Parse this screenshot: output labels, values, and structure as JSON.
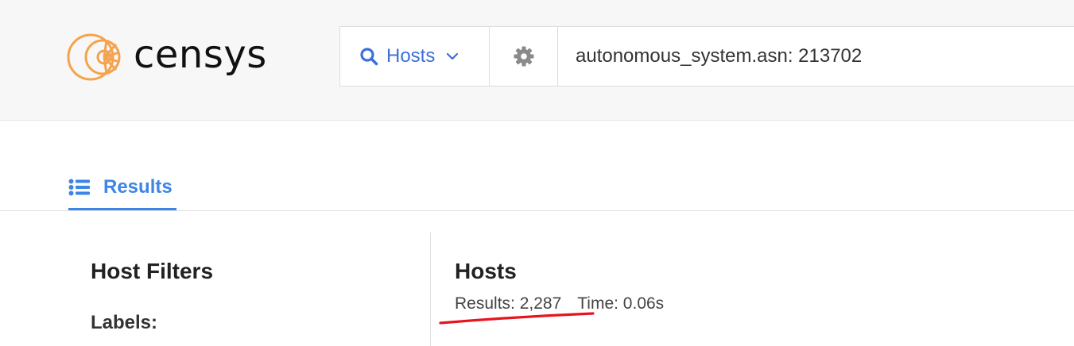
{
  "brand": {
    "name": "censys",
    "accent_color": "#f5a34d"
  },
  "search": {
    "type_label": "Hosts",
    "type_icon": "search-icon",
    "query": "autonomous_system.asn: 213702",
    "link_color": "#3d6fd9"
  },
  "tabs": [
    {
      "label": "Results",
      "icon": "list-icon",
      "active": true
    }
  ],
  "filters": {
    "title": "Host Filters",
    "labels_heading": "Labels:"
  },
  "results": {
    "title": "Hosts",
    "count_text": "Results: 2,287",
    "time_text": "Time: 0.06s",
    "annotation_color": "#e8141c"
  }
}
